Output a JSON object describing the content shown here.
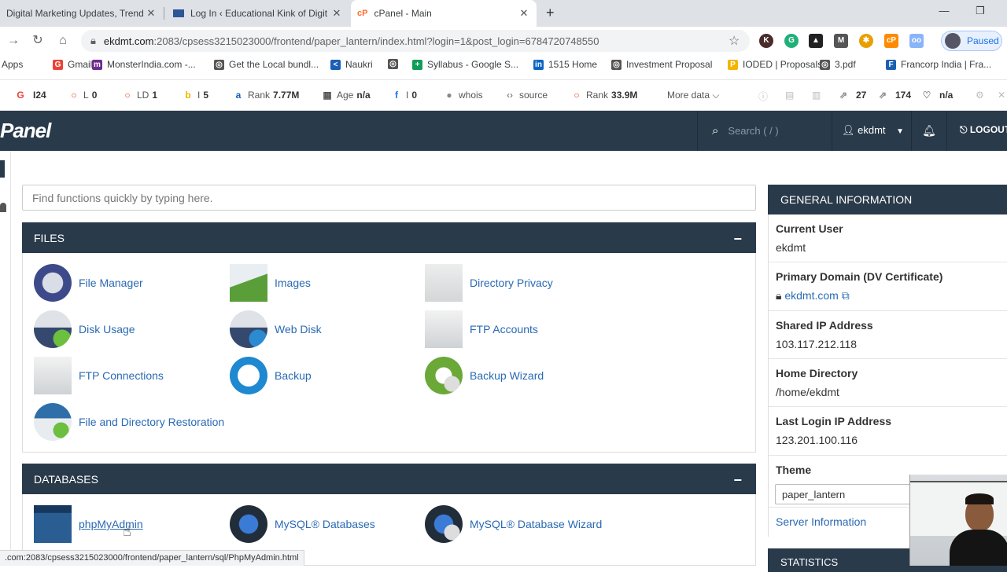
{
  "browser": {
    "tabs": [
      {
        "title": "Digital Marketing Updates, Trend",
        "active": false
      },
      {
        "title": "Log In ‹ Educational Kink of Digit",
        "active": false
      },
      {
        "title": "cPanel - Main",
        "active": true
      }
    ],
    "new_tab": "+",
    "url_host": "ekdmt.com",
    "url_rest": ":2083/cpsess3215023000/frontend/paper_lantern/index.html?login=1&post_login=6784720748550",
    "profile_label": "Paused",
    "bookmarks": [
      {
        "label": "Apps"
      },
      {
        "label": "Gmail",
        "icon": "G",
        "color": "#ea4335"
      },
      {
        "label": "MonsterIndia.com -...",
        "icon": "m",
        "color": "#6d2c8f"
      },
      {
        "label": "Get the Local bundl...",
        "icon": "◎",
        "color": "#555555"
      },
      {
        "label": "Naukri",
        "icon": "<",
        "color": "#1a5fb4"
      },
      {
        "label": "",
        "icon": "◎",
        "color": "#555555"
      },
      {
        "label": "Syllabus - Google S...",
        "icon": "+",
        "color": "#0f9d58"
      },
      {
        "label": "1515 Home",
        "icon": "in",
        "color": "#0a66c2"
      },
      {
        "label": "Investment Proposal",
        "icon": "◎",
        "color": "#555555"
      },
      {
        "label": "IODED | Proposals",
        "icon": "P",
        "color": "#f5b400"
      },
      {
        "label": "3.pdf",
        "icon": "◎",
        "color": "#555555"
      },
      {
        "label": "Francorp India | Fra...",
        "icon": "F",
        "color": "#1a5fb4"
      }
    ]
  },
  "seo_bar": [
    {
      "icon": "G",
      "label": "",
      "value": "I24",
      "color": "#ea4335"
    },
    {
      "icon": "○",
      "label": "L",
      "value": "0",
      "color": "#d84315"
    },
    {
      "icon": "○",
      "label": "LD",
      "value": "1",
      "color": "#d84315"
    },
    {
      "icon": "b",
      "label": "I",
      "value": "5",
      "color": "#f5b400"
    },
    {
      "icon": "a",
      "label": "Rank",
      "value": "7.77M",
      "color": "#1a5fb4"
    },
    {
      "icon": "▦",
      "label": "Age",
      "value": "n/a",
      "color": "#555555"
    },
    {
      "icon": "f",
      "label": "I",
      "value": "0",
      "color": "#1877f2"
    },
    {
      "icon": "●",
      "label": "whois",
      "value": "",
      "color": "#888888"
    },
    {
      "icon": "‹›",
      "label": "source",
      "value": "",
      "color": "#888888"
    },
    {
      "icon": "○",
      "label": "Rank",
      "value": "33.9M",
      "color": "#d84315"
    },
    {
      "icon": "",
      "label": "More data ⌵",
      "value": "",
      "color": "#555555"
    },
    {
      "icon": "⇗",
      "label": "",
      "value": "27",
      "color": "#888888"
    },
    {
      "icon": "⇗",
      "label": "",
      "value": "174",
      "color": "#888888"
    },
    {
      "icon": "♡",
      "label": "",
      "value": "n/a",
      "color": "#888888"
    }
  ],
  "cpanel": {
    "logo": "Panel",
    "search_placeholder": "Search ( / )",
    "username": "ekdmt",
    "logout": "LOGOUT",
    "quick_find_placeholder": "Find functions quickly by typing here.",
    "files_title": "FILES",
    "files": [
      {
        "label": "File Manager",
        "icon": "file-manager-icon"
      },
      {
        "label": "Images",
        "icon": "images-icon"
      },
      {
        "label": "Directory Privacy",
        "icon": "directory-privacy-icon"
      },
      {
        "label": "Disk Usage",
        "icon": "disk-usage-icon"
      },
      {
        "label": "Web Disk",
        "icon": "web-disk-icon"
      },
      {
        "label": "FTP Accounts",
        "icon": "ftp-accounts-icon"
      },
      {
        "label": "FTP Connections",
        "icon": "ftp-connections-icon"
      },
      {
        "label": "Backup",
        "icon": "backup-icon"
      },
      {
        "label": "Backup Wizard",
        "icon": "backup-wizard-icon"
      },
      {
        "label": "File and Directory Restoration",
        "icon": "file-restoration-icon"
      }
    ],
    "databases_title": "DATABASES",
    "databases": [
      {
        "label": "phpMyAdmin",
        "icon": "phpmyadmin-icon"
      },
      {
        "label": "MySQL® Databases",
        "icon": "mysql-databases-icon"
      },
      {
        "label": "MySQL® Database Wizard",
        "icon": "mysql-wizard-icon"
      }
    ],
    "collapse_symbol": "−"
  },
  "general_info": {
    "title": "GENERAL INFORMATION",
    "current_user_label": "Current User",
    "current_user": "ekdmt",
    "primary_domain_label": "Primary Domain (DV Certificate)",
    "primary_domain": "ekdmt.com",
    "shared_ip_label": "Shared IP Address",
    "shared_ip": "103.117.212.118",
    "home_dir_label": "Home Directory",
    "home_dir": "/home/ekdmt",
    "last_login_label": "Last Login IP Address",
    "last_login": "123.201.100.116",
    "theme_label": "Theme",
    "theme": "paper_lantern",
    "server_info": "Server Information",
    "statistics_title": "STATISTICS"
  },
  "status_url": ".com:2083/cpsess3215023000/frontend/paper_lantern/sql/PhpMyAdmin.html"
}
